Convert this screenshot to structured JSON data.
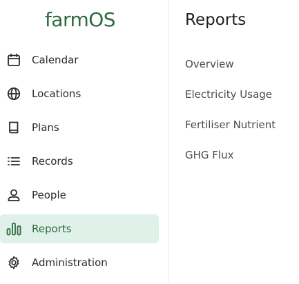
{
  "brand": {
    "name": "farmOS"
  },
  "sidebar": {
    "items": [
      {
        "label": "Calendar",
        "icon": "calendar-icon",
        "active": false
      },
      {
        "label": "Locations",
        "icon": "globe-icon",
        "active": false
      },
      {
        "label": "Plans",
        "icon": "book-icon",
        "active": false
      },
      {
        "label": "Records",
        "icon": "list-icon",
        "active": false
      },
      {
        "label": "People",
        "icon": "person-icon",
        "active": false
      },
      {
        "label": "Reports",
        "icon": "bar-chart-icon",
        "active": true
      },
      {
        "label": "Administration",
        "icon": "gear-icon",
        "active": false
      }
    ]
  },
  "main": {
    "title": "Reports",
    "links": [
      {
        "label": "Overview"
      },
      {
        "label": "Electricity Usage"
      },
      {
        "label": "Fertiliser Nutrient"
      },
      {
        "label": "GHG Flux"
      }
    ]
  },
  "colors": {
    "brand": "#2e6b3f",
    "active_background": "#dff1e8",
    "text": "#2b2b2b",
    "muted_text": "#4a4a4a",
    "divider": "#ececec"
  }
}
